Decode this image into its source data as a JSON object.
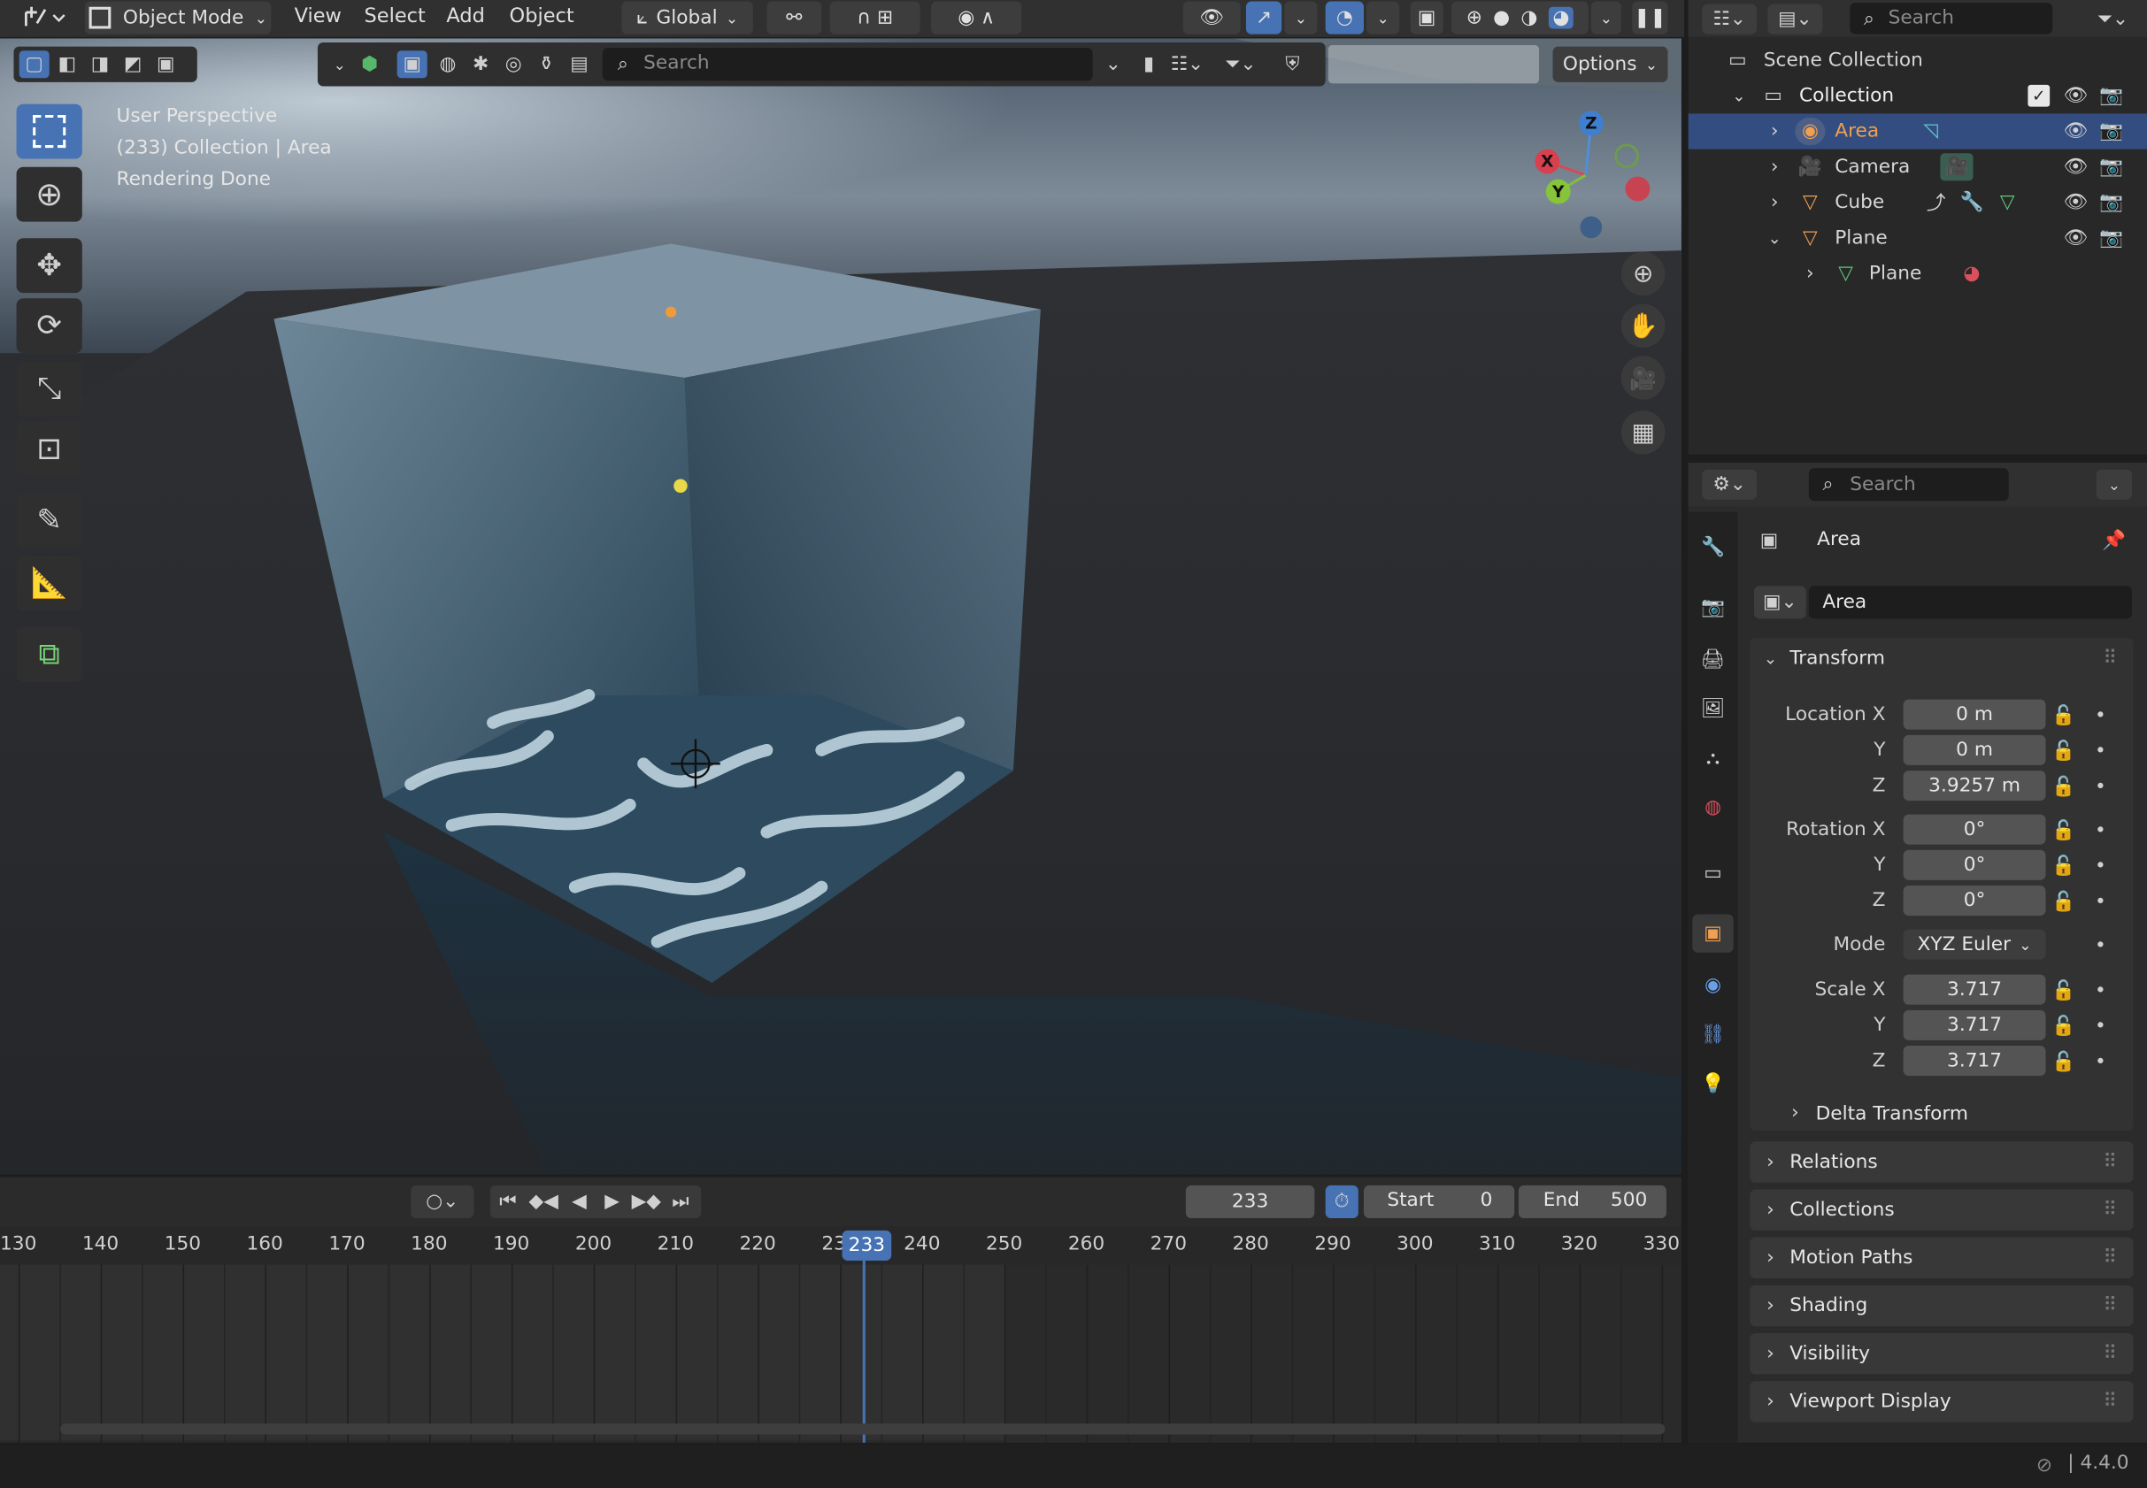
{
  "header": {
    "mode": "Object Mode",
    "menus": [
      "View",
      "Select",
      "Add",
      "Object"
    ],
    "orientation": "Global",
    "options_label": "Options",
    "search_placeholder": "Search"
  },
  "viewport": {
    "info": [
      "User Perspective",
      "(233) Collection | Area",
      "Rendering Done"
    ],
    "gizmo": {
      "x": "X",
      "y": "Y",
      "z": "Z"
    }
  },
  "outliner": {
    "search_placeholder": "Search",
    "scene_collection": "Scene Collection",
    "collection": "Collection",
    "items": [
      {
        "label": "Area",
        "selected": true
      },
      {
        "label": "Camera",
        "selected": false
      },
      {
        "label": "Cube",
        "selected": false
      },
      {
        "label": "Plane",
        "selected": false
      }
    ],
    "child": "Plane"
  },
  "properties": {
    "search_placeholder": "Search",
    "object_name": "Area",
    "object_field": "Area",
    "transform_label": "Transform",
    "location": {
      "label": "Location X",
      "x": "0 m",
      "y": "0 m",
      "z": "3.9257 m"
    },
    "rotation": {
      "label": "Rotation X",
      "x": "0°",
      "y": "0°",
      "z": "0°"
    },
    "mode": {
      "label": "Mode",
      "value": "XYZ Euler"
    },
    "scale": {
      "label": "Scale X",
      "x": "3.717",
      "y": "3.717",
      "z": "3.717"
    },
    "axis": {
      "y": "Y",
      "z": "Z"
    },
    "delta": "Delta Transform",
    "panels": [
      "Relations",
      "Collections",
      "Motion Paths",
      "Shading",
      "Visibility",
      "Viewport Display"
    ]
  },
  "timeline": {
    "current_frame": "233",
    "start_label": "Start",
    "start": "0",
    "end_label": "End",
    "end": "500",
    "ticks": [
      "130",
      "140",
      "150",
      "160",
      "170",
      "180",
      "190",
      "200",
      "210",
      "220",
      "23",
      "240",
      "250",
      "260",
      "270",
      "280",
      "290",
      "300",
      "310",
      "320",
      "330"
    ],
    "playhead": "233"
  },
  "status": {
    "version": "4.4.0"
  }
}
